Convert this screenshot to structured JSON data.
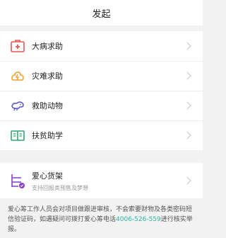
{
  "header": {
    "title": "发起"
  },
  "categories": [
    {
      "label": "大病求助",
      "icon": "medical-kit-icon",
      "color": "#e8554e"
    },
    {
      "label": "灾难求助",
      "icon": "disaster-icon",
      "color": "#f0a12e"
    },
    {
      "label": "救助动物",
      "icon": "animal-icon",
      "color": "#5a5ad2"
    },
    {
      "label": "扶贫助学",
      "icon": "book-icon",
      "color": "#2ea86f"
    }
  ],
  "shelf": {
    "title": "爱心货架",
    "subtitle": "支持回报类预售及梦想",
    "icon": "shelf-icon",
    "color": "#8a3cc8"
  },
  "notice": {
    "text_before": "爱心筹工作人员会对项目做跟进审核，不会索要财物及各类密码短信验证码，如遇疑问可拨打爱心筹电话",
    "phone": "4006-526-559",
    "text_after": "进行核实举报。"
  }
}
